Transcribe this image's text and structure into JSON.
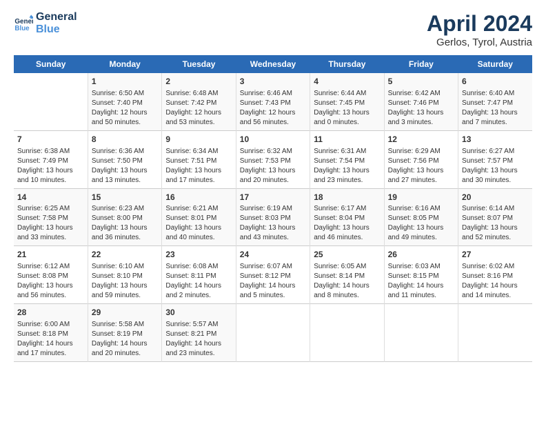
{
  "header": {
    "logo_line1": "General",
    "logo_line2": "Blue",
    "month_year": "April 2024",
    "location": "Gerlos, Tyrol, Austria"
  },
  "days_of_week": [
    "Sunday",
    "Monday",
    "Tuesday",
    "Wednesday",
    "Thursday",
    "Friday",
    "Saturday"
  ],
  "weeks": [
    [
      {
        "day": "",
        "empty": true
      },
      {
        "day": "1",
        "sunrise": "Sunrise: 6:50 AM",
        "sunset": "Sunset: 7:40 PM",
        "daylight": "Daylight: 12 hours and 50 minutes."
      },
      {
        "day": "2",
        "sunrise": "Sunrise: 6:48 AM",
        "sunset": "Sunset: 7:42 PM",
        "daylight": "Daylight: 12 hours and 53 minutes."
      },
      {
        "day": "3",
        "sunrise": "Sunrise: 6:46 AM",
        "sunset": "Sunset: 7:43 PM",
        "daylight": "Daylight: 12 hours and 56 minutes."
      },
      {
        "day": "4",
        "sunrise": "Sunrise: 6:44 AM",
        "sunset": "Sunset: 7:45 PM",
        "daylight": "Daylight: 13 hours and 0 minutes."
      },
      {
        "day": "5",
        "sunrise": "Sunrise: 6:42 AM",
        "sunset": "Sunset: 7:46 PM",
        "daylight": "Daylight: 13 hours and 3 minutes."
      },
      {
        "day": "6",
        "sunrise": "Sunrise: 6:40 AM",
        "sunset": "Sunset: 7:47 PM",
        "daylight": "Daylight: 13 hours and 7 minutes."
      }
    ],
    [
      {
        "day": "7",
        "sunrise": "Sunrise: 6:38 AM",
        "sunset": "Sunset: 7:49 PM",
        "daylight": "Daylight: 13 hours and 10 minutes."
      },
      {
        "day": "8",
        "sunrise": "Sunrise: 6:36 AM",
        "sunset": "Sunset: 7:50 PM",
        "daylight": "Daylight: 13 hours and 13 minutes."
      },
      {
        "day": "9",
        "sunrise": "Sunrise: 6:34 AM",
        "sunset": "Sunset: 7:51 PM",
        "daylight": "Daylight: 13 hours and 17 minutes."
      },
      {
        "day": "10",
        "sunrise": "Sunrise: 6:32 AM",
        "sunset": "Sunset: 7:53 PM",
        "daylight": "Daylight: 13 hours and 20 minutes."
      },
      {
        "day": "11",
        "sunrise": "Sunrise: 6:31 AM",
        "sunset": "Sunset: 7:54 PM",
        "daylight": "Daylight: 13 hours and 23 minutes."
      },
      {
        "day": "12",
        "sunrise": "Sunrise: 6:29 AM",
        "sunset": "Sunset: 7:56 PM",
        "daylight": "Daylight: 13 hours and 27 minutes."
      },
      {
        "day": "13",
        "sunrise": "Sunrise: 6:27 AM",
        "sunset": "Sunset: 7:57 PM",
        "daylight": "Daylight: 13 hours and 30 minutes."
      }
    ],
    [
      {
        "day": "14",
        "sunrise": "Sunrise: 6:25 AM",
        "sunset": "Sunset: 7:58 PM",
        "daylight": "Daylight: 13 hours and 33 minutes."
      },
      {
        "day": "15",
        "sunrise": "Sunrise: 6:23 AM",
        "sunset": "Sunset: 8:00 PM",
        "daylight": "Daylight: 13 hours and 36 minutes."
      },
      {
        "day": "16",
        "sunrise": "Sunrise: 6:21 AM",
        "sunset": "Sunset: 8:01 PM",
        "daylight": "Daylight: 13 hours and 40 minutes."
      },
      {
        "day": "17",
        "sunrise": "Sunrise: 6:19 AM",
        "sunset": "Sunset: 8:03 PM",
        "daylight": "Daylight: 13 hours and 43 minutes."
      },
      {
        "day": "18",
        "sunrise": "Sunrise: 6:17 AM",
        "sunset": "Sunset: 8:04 PM",
        "daylight": "Daylight: 13 hours and 46 minutes."
      },
      {
        "day": "19",
        "sunrise": "Sunrise: 6:16 AM",
        "sunset": "Sunset: 8:05 PM",
        "daylight": "Daylight: 13 hours and 49 minutes."
      },
      {
        "day": "20",
        "sunrise": "Sunrise: 6:14 AM",
        "sunset": "Sunset: 8:07 PM",
        "daylight": "Daylight: 13 hours and 52 minutes."
      }
    ],
    [
      {
        "day": "21",
        "sunrise": "Sunrise: 6:12 AM",
        "sunset": "Sunset: 8:08 PM",
        "daylight": "Daylight: 13 hours and 56 minutes."
      },
      {
        "day": "22",
        "sunrise": "Sunrise: 6:10 AM",
        "sunset": "Sunset: 8:10 PM",
        "daylight": "Daylight: 13 hours and 59 minutes."
      },
      {
        "day": "23",
        "sunrise": "Sunrise: 6:08 AM",
        "sunset": "Sunset: 8:11 PM",
        "daylight": "Daylight: 14 hours and 2 minutes."
      },
      {
        "day": "24",
        "sunrise": "Sunrise: 6:07 AM",
        "sunset": "Sunset: 8:12 PM",
        "daylight": "Daylight: 14 hours and 5 minutes."
      },
      {
        "day": "25",
        "sunrise": "Sunrise: 6:05 AM",
        "sunset": "Sunset: 8:14 PM",
        "daylight": "Daylight: 14 hours and 8 minutes."
      },
      {
        "day": "26",
        "sunrise": "Sunrise: 6:03 AM",
        "sunset": "Sunset: 8:15 PM",
        "daylight": "Daylight: 14 hours and 11 minutes."
      },
      {
        "day": "27",
        "sunrise": "Sunrise: 6:02 AM",
        "sunset": "Sunset: 8:16 PM",
        "daylight": "Daylight: 14 hours and 14 minutes."
      }
    ],
    [
      {
        "day": "28",
        "sunrise": "Sunrise: 6:00 AM",
        "sunset": "Sunset: 8:18 PM",
        "daylight": "Daylight: 14 hours and 17 minutes."
      },
      {
        "day": "29",
        "sunrise": "Sunrise: 5:58 AM",
        "sunset": "Sunset: 8:19 PM",
        "daylight": "Daylight: 14 hours and 20 minutes."
      },
      {
        "day": "30",
        "sunrise": "Sunrise: 5:57 AM",
        "sunset": "Sunset: 8:21 PM",
        "daylight": "Daylight: 14 hours and 23 minutes."
      },
      {
        "day": "",
        "empty": true
      },
      {
        "day": "",
        "empty": true
      },
      {
        "day": "",
        "empty": true
      },
      {
        "day": "",
        "empty": true
      }
    ]
  ]
}
